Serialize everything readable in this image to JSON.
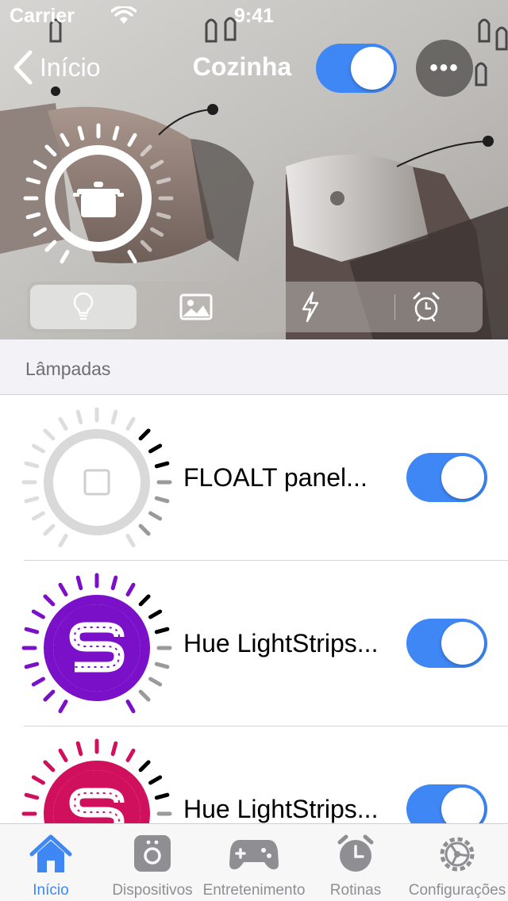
{
  "status_bar": {
    "carrier": "Carrier",
    "time": "9:41"
  },
  "nav": {
    "back_label": "Início",
    "title": "Cozinha",
    "room_on": true
  },
  "room": {
    "icon": "pot-icon"
  },
  "segments": [
    {
      "name": "lightbulb-icon",
      "active": true
    },
    {
      "name": "image-icon",
      "active": false
    },
    {
      "name": "lightning-icon",
      "active": false
    },
    {
      "name": "alarm-clock-icon",
      "active": false
    }
  ],
  "section": {
    "title": "Lâmpadas"
  },
  "lamps": [
    {
      "name": "FLOALT panel...",
      "on": true,
      "color": "#d9d9d9",
      "icon": "square-panel-icon"
    },
    {
      "name": "Hue LightStrips...",
      "on": true,
      "color": "#7a10c8",
      "icon": "lightstrip-icon"
    },
    {
      "name": "Hue LightStrips...",
      "on": true,
      "color": "#d0105c",
      "icon": "lightstrip-icon"
    }
  ],
  "tabbar": {
    "tabs": [
      {
        "label": "Início",
        "icon": "home-icon",
        "active": true
      },
      {
        "label": "Dispositivos",
        "icon": "device-icon",
        "active": false
      },
      {
        "label": "Entretenimento",
        "icon": "gamepad-icon",
        "active": false
      },
      {
        "label": "Rotinas",
        "icon": "clock-icon",
        "active": false
      },
      {
        "label": "Configurações",
        "icon": "settings-icon",
        "active": false
      }
    ]
  },
  "colors": {
    "accent": "#3e87f5",
    "toggle_on": "#3e87f5",
    "section_bg": "#f2f2f7"
  }
}
